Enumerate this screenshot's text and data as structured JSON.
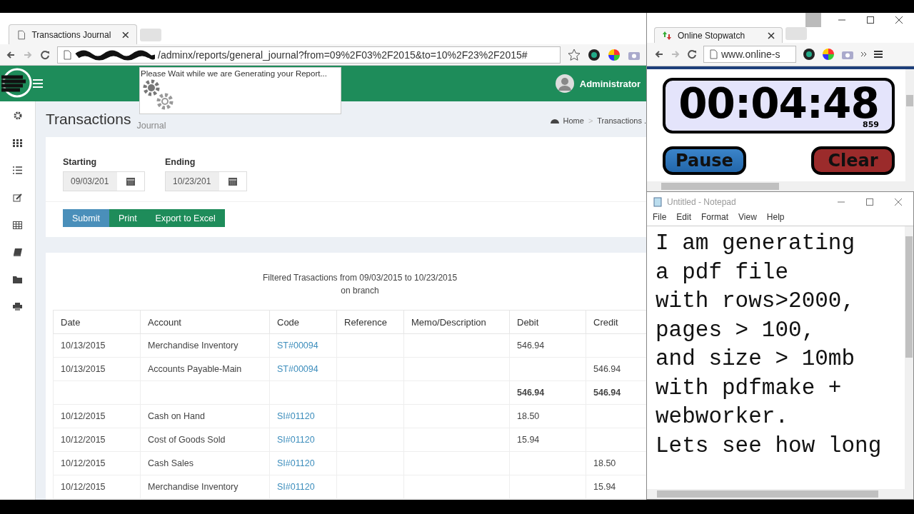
{
  "main_browser": {
    "tab_title": "Transactions Journal",
    "url": "/adminx/reports/general_journal?from=09%2F03%2F2015&to=10%2F23%2F2015#",
    "loading_popup": {
      "message": "Please Wait while we are Generating your Report..."
    },
    "user_name": "Administrator",
    "page": {
      "title": "Transactions",
      "subtitle": "Journal",
      "breadcrumbs": [
        "Home",
        "Transactions ."
      ],
      "breadcrumb_separator": ">"
    },
    "filters": [
      {
        "label": "Starting",
        "value": "09/03/201"
      },
      {
        "label": "Ending",
        "value": "10/23/201"
      }
    ],
    "buttons": [
      {
        "label": "Submit",
        "kind": "primary"
      },
      {
        "label": "Print",
        "kind": "success"
      },
      {
        "label": "Export to Excel",
        "kind": "success"
      }
    ],
    "report": {
      "heading": "Filtered Trasactions from 09/03/2015 to 10/23/2015",
      "subheading": "on branch",
      "columns": [
        "Date",
        "Account",
        "Code",
        "Reference",
        "Memo/Description",
        "Debit",
        "Credit"
      ],
      "rows": [
        {
          "kind": "entry",
          "date": "10/13/2015",
          "account": "Merchandise Inventory",
          "code": "ST#00094",
          "debit": "546.94"
        },
        {
          "kind": "entry",
          "date": "10/13/2015",
          "account": "Accounts Payable-Main",
          "code": "ST#00094",
          "credit": "546.94"
        },
        {
          "kind": "total",
          "debit": "546.94",
          "credit": "546.94"
        },
        {
          "kind": "entry",
          "date": "10/12/2015",
          "account": "Cash on Hand",
          "code": "SI#01120",
          "debit": "18.50"
        },
        {
          "kind": "entry",
          "date": "10/12/2015",
          "account": "Cost of Goods Sold",
          "code": "SI#01120",
          "debit": "15.94"
        },
        {
          "kind": "entry",
          "date": "10/12/2015",
          "account": "Cash Sales",
          "code": "SI#01120",
          "credit": "18.50"
        },
        {
          "kind": "entry",
          "date": "10/12/2015",
          "account": "Merchandise Inventory",
          "code": "SI#01120",
          "credit": "15.94"
        }
      ]
    }
  },
  "stopwatch_browser": {
    "tab_title": "Online Stopwatch",
    "url": "www.online-s",
    "time": "00:04:48",
    "milliseconds": "859",
    "buttons": [
      {
        "label": "Pause",
        "kind": "pause"
      },
      {
        "label": "Clear",
        "kind": "clear"
      }
    ]
  },
  "notepad": {
    "title": "Untitled - Notepad",
    "menu": [
      "File",
      "Edit",
      "Format",
      "View",
      "Help"
    ],
    "lines": [
      "I am generating",
      "a pdf file",
      "with rows>2000,",
      "pages > 100,",
      "and size > 10mb",
      "with pdfmake +",
      "webworker.",
      "Lets see how long"
    ]
  }
}
